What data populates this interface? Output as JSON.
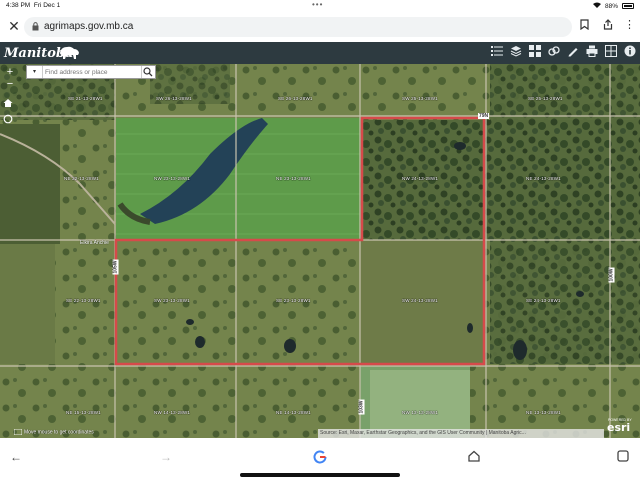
{
  "status": {
    "time": "4:38 PM",
    "date": "Fri Dec 1",
    "battery": "88%"
  },
  "browser": {
    "url": "agrimaps.gov.mb.ca"
  },
  "app": {
    "logo": "Manitoba",
    "tools": [
      "legend-icon",
      "layers-icon",
      "basemap-icon",
      "link-icon",
      "draw-icon",
      "print-icon",
      "export-icon",
      "info-icon"
    ]
  },
  "search": {
    "placeholder": "Find address or place"
  },
  "map": {
    "labels": [
      "SE 21-13-28W1",
      "SW 26-13-28W1",
      "SE 26-13-28W1",
      "SW 25-13-28W1",
      "SE 25-13-28W1",
      "NE 22-13-28W1",
      "NW 23-13-28W1",
      "NE 23-13-28W1",
      "NW 24-13-28W1",
      "NE 24-13-28W1",
      "SE 22-13-28W1",
      "SW 23-13-28W1",
      "SE 23-13-28W1",
      "SW 24-13-28W1",
      "SE 24-13-28W1",
      "NE 15-13-28W1",
      "NW 14-13-28W1",
      "NE 14-13-28W1",
      "NW 13-13-28W1",
      "NE 13-13-28W1"
    ],
    "roads": [
      "79N",
      "105W",
      "100W",
      "103W"
    ],
    "place": "Elkira Anchie",
    "coords_text": "Move mouse to get coordinates",
    "attribution": "Source: Esri, Maxar, Earthstar Geographics, and the GIS User Community | Manitoba Agric...",
    "esri_sub": "POWERED BY",
    "esri": "esri"
  }
}
